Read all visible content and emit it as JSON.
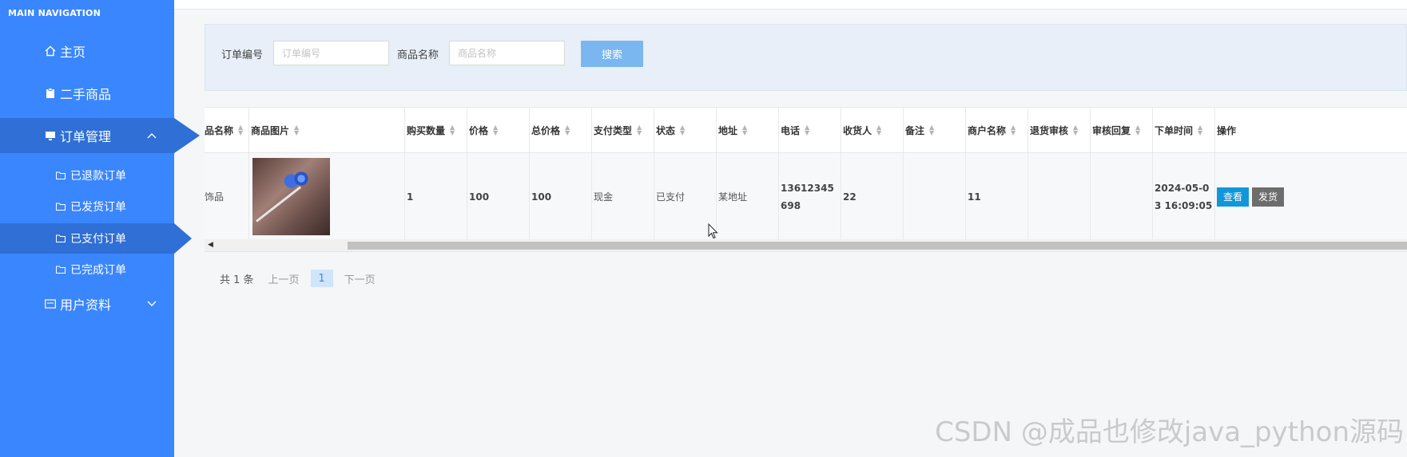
{
  "sidebar": {
    "header": "MAIN NAVIGATION",
    "items": [
      {
        "label": "主页"
      },
      {
        "label": "二手商品"
      },
      {
        "label": "订单管理"
      },
      {
        "label": "已退款订单"
      },
      {
        "label": "已发货订单"
      },
      {
        "label": "已支付订单"
      },
      {
        "label": "已完成订单"
      },
      {
        "label": "用户资料"
      }
    ],
    "caret_up": "︿",
    "caret_down": "﹀"
  },
  "search": {
    "order_no_label": "订单编号",
    "order_no_placeholder": "订单编号",
    "product_name_label": "商品名称",
    "product_name_placeholder": "商品名称",
    "button": "搜索"
  },
  "table": {
    "headers": [
      "商品名称",
      "商品图片",
      "购买数量",
      "价格",
      "总价格",
      "支付类型",
      "状态",
      "地址",
      "电话",
      "收货人",
      "备注",
      "商户名称",
      "退货审核",
      "审核回复",
      "下单时间",
      "操作"
    ],
    "row": {
      "name": "装饰品",
      "quantity": "1",
      "price": "100",
      "total": "100",
      "pay_type": "现金",
      "status": "已支付",
      "address": "某地址",
      "phone": "13612345698",
      "receiver": "22",
      "remark": "",
      "merchant": "11",
      "return_review": "",
      "review_reply": "",
      "order_time": "2024-05-03 16:09:05",
      "view_btn": "查看",
      "ship_btn": "发货"
    }
  },
  "pagination": {
    "total": "共 1 条",
    "prev": "上一页",
    "page": "1",
    "next": "下一页"
  },
  "watermark": "CSDN @成品也修改java_python源码",
  "colors": {
    "sidebar": "#3a86ff",
    "sidebar_active": "#2f6fd6",
    "view_btn": "#1296db",
    "ship_btn": "#6d6d6d",
    "search_btn": "#7ab7f0"
  }
}
